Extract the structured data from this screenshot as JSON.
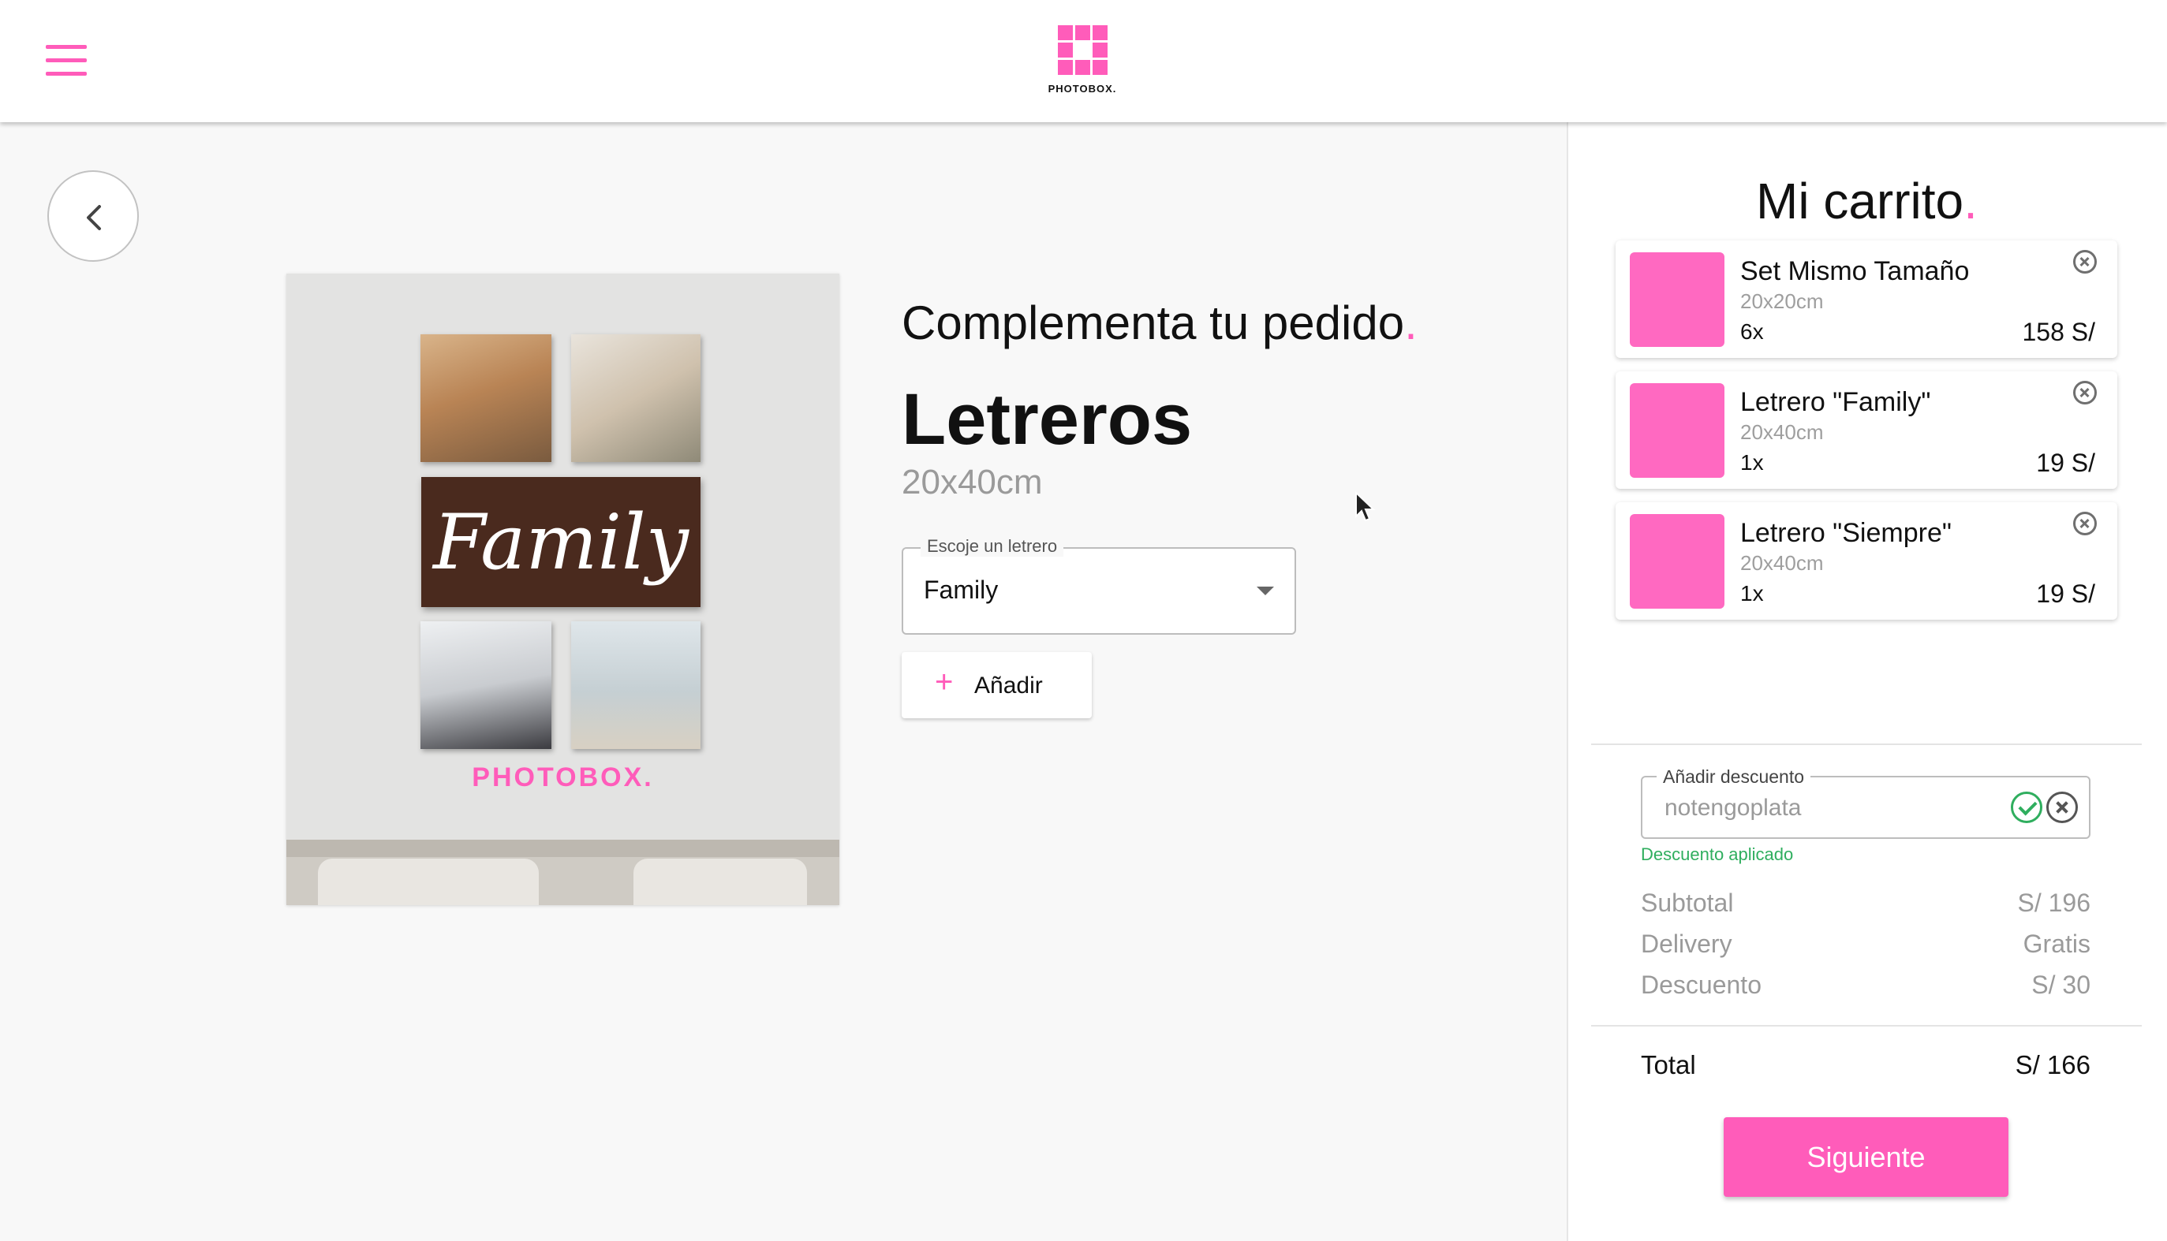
{
  "header": {
    "brand": "PHOTOBOX.",
    "menu_icon": "hamburger-menu-icon",
    "accent_color": "#ff5cba"
  },
  "main": {
    "back_icon": "chevron-left-icon",
    "section_title": "Complementa tu pedido",
    "section_title_dot": ".",
    "product_name": "Letreros",
    "product_size": "20x40cm",
    "image": {
      "sign_text": "Family",
      "brand_text": "PHOTOBOX."
    },
    "select": {
      "label": "Escoje un letrero",
      "value": "Family"
    },
    "add_button": {
      "icon": "+",
      "label": "Añadir"
    }
  },
  "cart": {
    "title": "Mi carrito",
    "title_dot": ".",
    "items": [
      {
        "name": "Set Mismo Tamaño",
        "size": "20x20cm",
        "qty": "6x",
        "price": "158 S/"
      },
      {
        "name": "Letrero \"Family\"",
        "size": "20x40cm",
        "qty": "1x",
        "price": "19 S/"
      },
      {
        "name": "Letrero \"Siempre\"",
        "size": "20x40cm",
        "qty": "1x",
        "price": "19 S/"
      }
    ],
    "discount": {
      "label": "Añadir descuento",
      "value": "notengoplata",
      "message": "Descuento aplicado",
      "status_color": "#2fae5e"
    },
    "summary": [
      {
        "label": "Subtotal",
        "value": "S/ 196"
      },
      {
        "label": "Delivery",
        "value": "Gratis"
      },
      {
        "label": "Descuento",
        "value": "S/ 30"
      }
    ],
    "total": {
      "label": "Total",
      "value": "S/ 166"
    },
    "next_button": "Siguiente"
  }
}
